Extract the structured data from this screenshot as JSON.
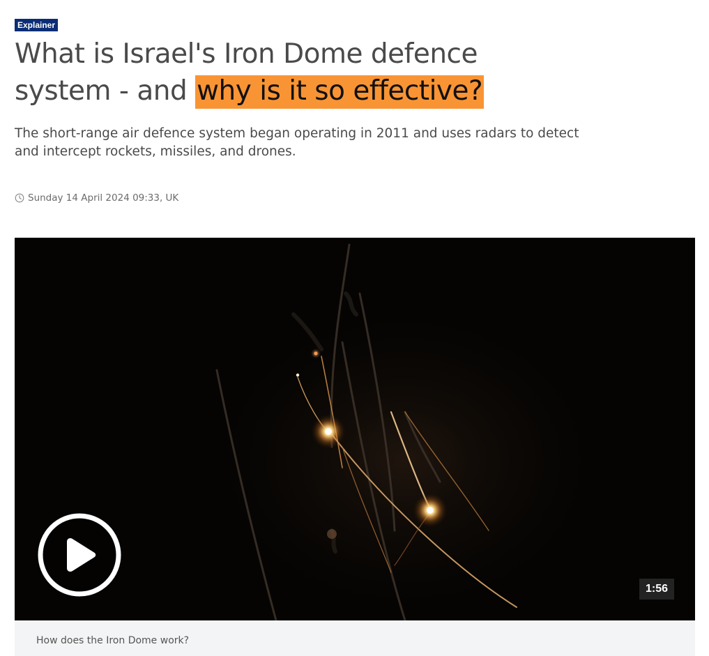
{
  "article": {
    "label": "Explainer",
    "headline_plain": "What is Israel's Iron Dome defence system - and",
    "headline_highlight": "why is it so effective?",
    "standfirst": "The short-range air defence system began operating in 2011 and uses radars to detect and intercept rockets, missiles, and drones.",
    "timestamp": "Sunday 14 April 2024 09:33, UK"
  },
  "video": {
    "duration": "1:56",
    "caption": "How does the Iron Dome work?"
  },
  "colors": {
    "label_bg": "#0b2d75",
    "highlight": "#f99434",
    "caption_bg": "#f3f4f5"
  },
  "icons": {
    "timestamp": "clock-icon",
    "video": "play-icon"
  }
}
